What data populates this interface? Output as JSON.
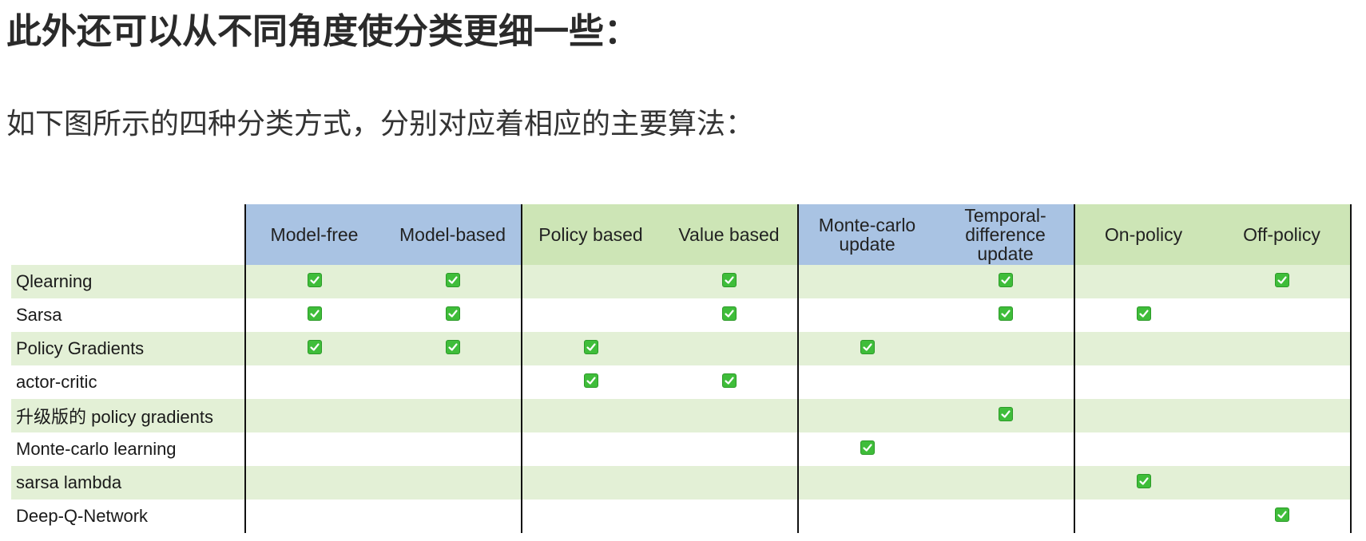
{
  "heading": "此外还可以从不同角度使分类更细一些：",
  "intro": "如下图所示的四种分类方式，分别对应着相应的主要算法：",
  "colors": {
    "header_blue": "#a9c3e3",
    "header_green": "#cde5b6",
    "row_stripe": "#e3f0d6",
    "check_green": "#3fbd3a"
  },
  "table": {
    "groups": [
      {
        "color": "header_blue",
        "columns": [
          "Model-free",
          "Model-based"
        ]
      },
      {
        "color": "header_green",
        "columns": [
          "Policy based",
          "Value based"
        ]
      },
      {
        "color": "header_blue",
        "columns": [
          "Monte-carlo\nupdate",
          "Temporal-\ndifference\nupdate"
        ]
      },
      {
        "color": "header_green",
        "columns": [
          "On-policy",
          "Off-policy"
        ]
      }
    ],
    "rows": [
      {
        "label": "Qlearning",
        "checks": [
          1,
          1,
          0,
          1,
          0,
          1,
          0,
          1
        ]
      },
      {
        "label": "Sarsa",
        "checks": [
          1,
          1,
          0,
          1,
          0,
          1,
          1,
          0
        ]
      },
      {
        "label": "Policy Gradients",
        "checks": [
          1,
          1,
          1,
          0,
          1,
          0,
          0,
          0
        ]
      },
      {
        "label": "actor-critic",
        "checks": [
          0,
          0,
          1,
          1,
          0,
          0,
          0,
          0
        ]
      },
      {
        "label": "升级版的 policy gradients",
        "checks": [
          0,
          0,
          0,
          0,
          0,
          1,
          0,
          0
        ]
      },
      {
        "label": "Monte-carlo learning",
        "checks": [
          0,
          0,
          0,
          0,
          1,
          0,
          0,
          0
        ]
      },
      {
        "label": "sarsa lambda",
        "checks": [
          0,
          0,
          0,
          0,
          0,
          0,
          1,
          0
        ]
      },
      {
        "label": "Deep-Q-Network",
        "checks": [
          0,
          0,
          0,
          0,
          0,
          0,
          0,
          1
        ]
      }
    ]
  }
}
